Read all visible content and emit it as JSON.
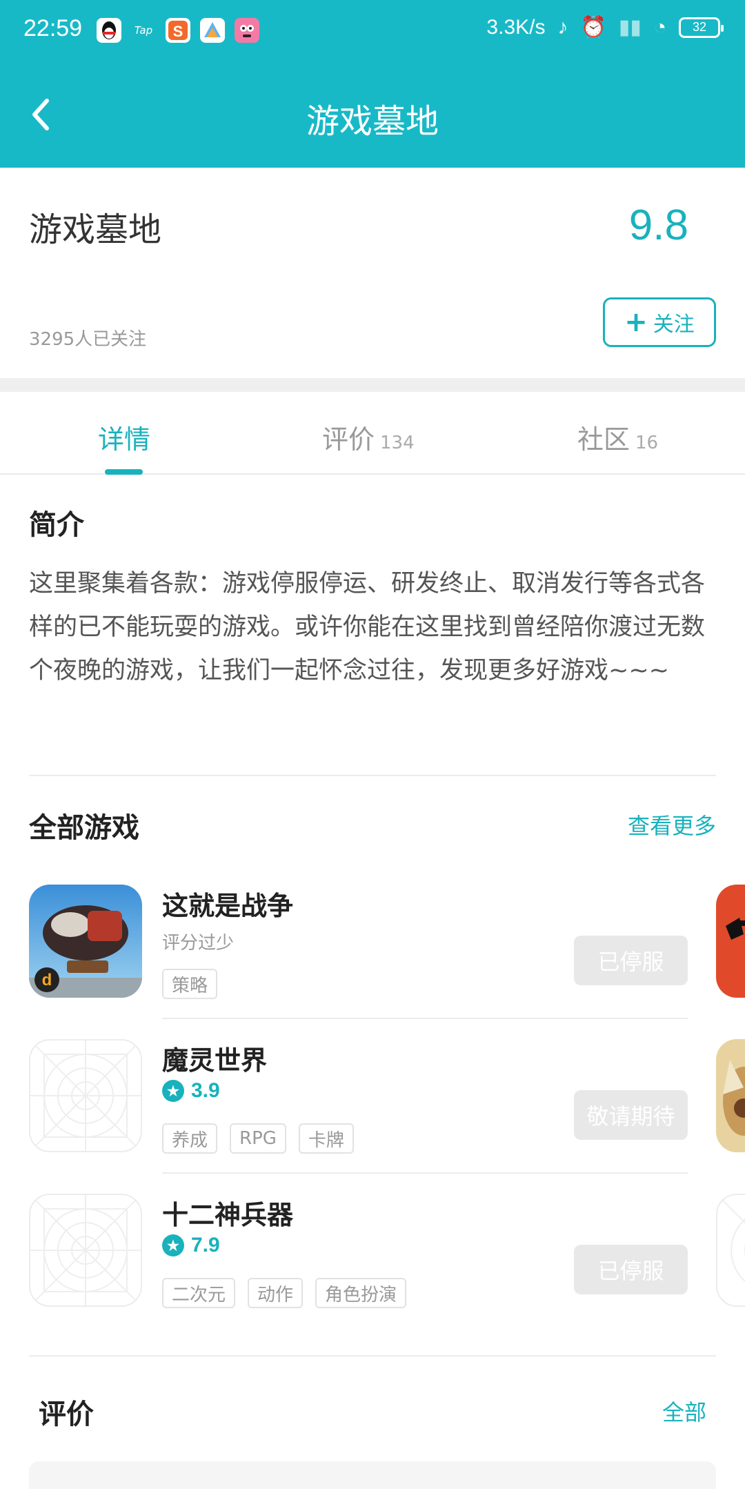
{
  "status_bar": {
    "time": "22:59",
    "net_speed": "3.3K/s",
    "battery": "32",
    "app_icons": [
      "qq-icon",
      "taptap-icon",
      "sohu-icon",
      "app-icon",
      "game-icon"
    ]
  },
  "header": {
    "title": "游戏墓地"
  },
  "info": {
    "name": "游戏墓地",
    "score": "9.8",
    "followers": "3295人已关注",
    "follow_label": "关注"
  },
  "tabs": [
    {
      "label": "详情",
      "count": ""
    },
    {
      "label": "评价",
      "count": "134"
    },
    {
      "label": "社区",
      "count": "16"
    }
  ],
  "intro": {
    "title": "简介",
    "text": "这里聚集着各款：游戏停服停运、研发终止、取消发行等各式各样的已不能玩耍的游戏。或许你能在这里找到曾经陪你渡过无数个夜晚的游戏，让我们一起怀念过往，发现更多好游戏~~~"
  },
  "games_section": {
    "title": "全部游戏",
    "more": "查看更多",
    "games": [
      {
        "name": "这就是战争",
        "sub": "评分过少",
        "rating": "",
        "tags": [
          "策略"
        ],
        "status": "已停服"
      },
      {
        "name": "魔灵世界",
        "sub": "",
        "rating": "3.9",
        "tags": [
          "养成",
          "RPG",
          "卡牌"
        ],
        "status": "敬请期待"
      },
      {
        "name": "十二神兵器",
        "sub": "",
        "rating": "7.9",
        "tags": [
          "二次元",
          "动作",
          "角色扮演"
        ],
        "status": "已停服"
      }
    ]
  },
  "reviews_section": {
    "title": "评价",
    "more": "全部"
  },
  "colors": {
    "accent": "#18b2bd",
    "header_bg": "#18b9c7"
  }
}
